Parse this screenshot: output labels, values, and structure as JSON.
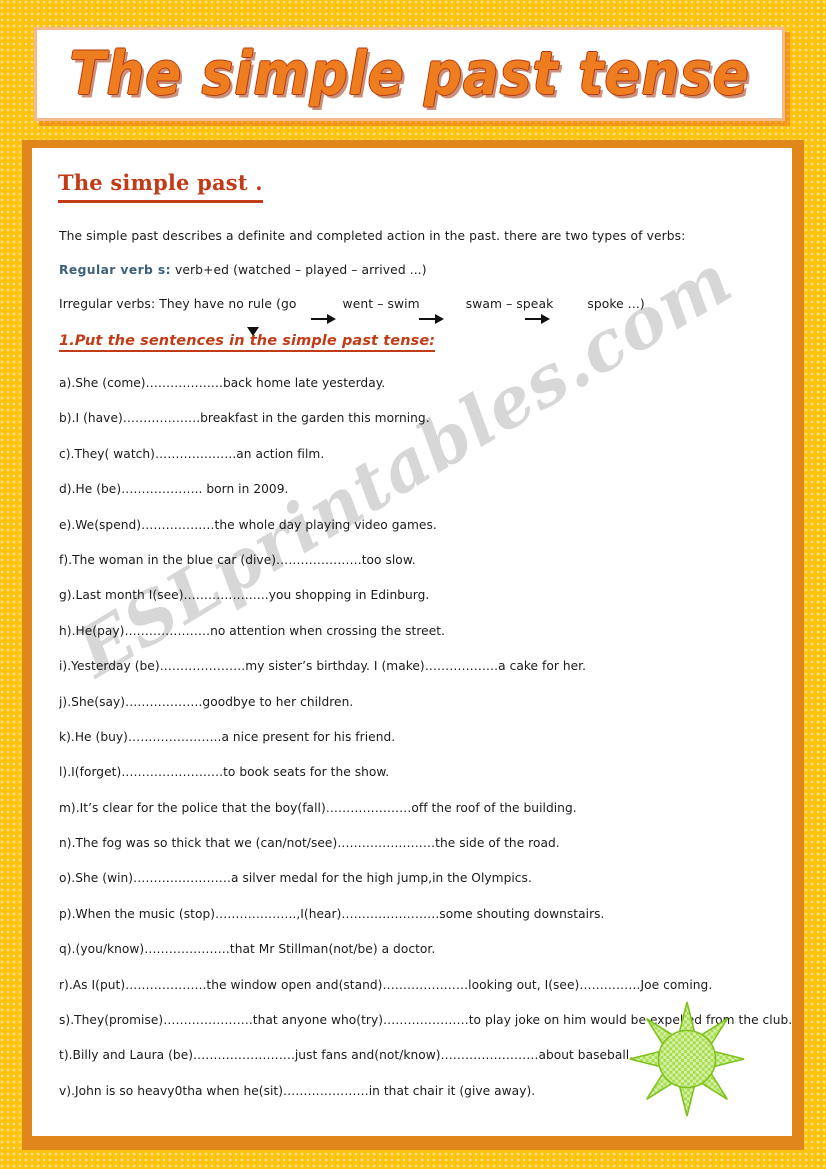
{
  "banner": {
    "title": "The simple past  tense"
  },
  "sheet": {
    "watermark": "ESLprintables.com",
    "section_heading": "The simple past .",
    "intro": "The simple past describes a definite and completed action in the past. there are two types of verbs:",
    "regular": {
      "label": "Regular verb s:",
      "text": "verb+ed (watched – played – arrived ...)"
    },
    "irregular": {
      "label": "Irregular verbs:",
      "lead": "They have no rule (go",
      "pair1": "went – swim",
      "pair2": "swam – speak",
      "pair3": "spoke ...)"
    },
    "exercise_heading": "1.Put the sentences in the simple past tense:",
    "items": [
      "a).She (come)……………….back home late yesterday.",
      "b).I (have)……………….breakfast in the garden this morning.",
      "c).They( watch)………………..an action film.",
      "d).He (be)……………….. born in 2009.",
      "e).We(spend)………………the whole day playing video games.",
      "f).The woman in the blue car (dive)…………………too slow.",
      "g).Last month I(see)…………….…..you shopping in Edinburg.",
      "h).He(pay)…………………no attention when crossing the street.",
      "i).Yesterday (be)…………………my sister’s birthday. I (make)………………a cake for her.",
      "j).She(say)……………….goodbye to her children.",
      "k).He (buy)…………………..a nice present for his friend.",
      " l).I(forget)…………………….to book seats for the show.",
      "m).It’s clear for the police that the boy(fall)…………………off the roof of the building.",
      "n).The fog was so thick that we (can/not/see)……………………the side of the road.",
      "o).She (win)……………………a silver medal for the high jump,in the Olympics.",
      "p).When the music (stop)………………..,I(hear)……………………some shouting downstairs.",
      "q).(you/know)…………………that Mr Stillman(not/be) a doctor.",
      "r).As I(put)………………..the window open and(stand)…………………looking out, I(see)……………Joe coming.",
      "s).They(promise)………………….that anyone who(try)…………………to play joke on him would be expelled from the club.",
      "t).Billy and Laura (be)…………………….just fans and(not/know)……………………about baseball.",
      "v).John is so heavy0tha when he(sit)…………………in that chair it (give away)."
    ]
  },
  "decor": {
    "sun_icon": "sun-icon",
    "sun_color": "#A8E05A",
    "arrow_icon": "right-arrow-icon",
    "triangle_icon": "down-triangle-icon"
  },
  "colors": {
    "page_background": "#FFC20E",
    "frame_orange": "#E0861A",
    "heading_red": "#C23B17",
    "title_orange": "#ED7D1F",
    "label_blue": "#3C607A",
    "watermark_gray": "#C9C9C9"
  }
}
